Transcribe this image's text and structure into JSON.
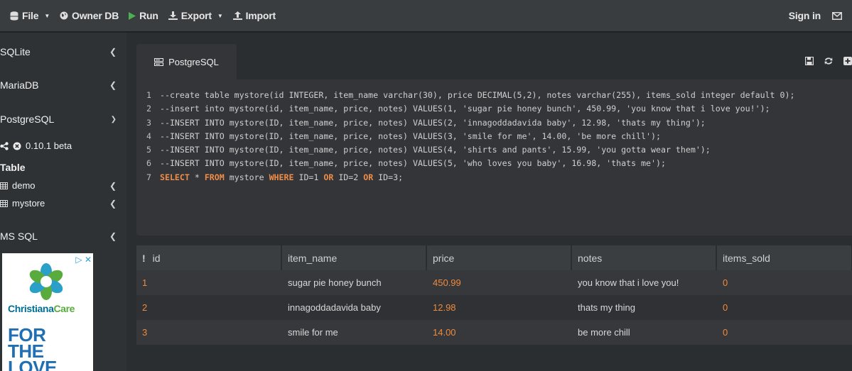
{
  "navbar": {
    "file": "File",
    "owner_db": "Owner DB",
    "run": "Run",
    "export": "Export",
    "import": "Import",
    "sign_in": "Sign in"
  },
  "sidebar": {
    "sqlite": "SQLite",
    "mariadb": "MariaDB",
    "postgresql": "PostgreSQL",
    "version": "0.10.1 beta",
    "table_heading": "Table",
    "tables": [
      "demo",
      "mystore"
    ],
    "mssql": "MS SQL"
  },
  "ad": {
    "brand_a": "Christiana",
    "brand_b": "Care",
    "headline": [
      "FOR",
      "THE",
      "LOVE"
    ]
  },
  "editor": {
    "tab_label": "PostgreSQL",
    "lines": [
      "--create table mystore(id INTEGER, item_name varchar(30), price DECIMAL(5,2), notes varchar(255), items_sold integer default 0);",
      "--insert into mystore(id, item_name, price, notes) VALUES(1, 'sugar pie honey bunch', 450.99, 'you know that i love you!');",
      "--INSERT INTO mystore(ID, item_name, price, notes) VALUES(2, 'innagoddadavida baby', 12.98, 'thats my thing');",
      "--INSERT INTO mystore(ID, item_name, price, notes) VALUES(3, 'smile for me', 14.00, 'be more chill');",
      "--INSERT INTO mystore(ID, item_name, price, notes) VALUES(4, 'shirts and pants', 15.99, 'you gotta wear them');",
      "--INSERT INTO mystore(ID, item_name, price, notes) VALUES(5, 'who loves you baby', 16.98, 'thats me');"
    ],
    "line_numbers": [
      "1",
      "2",
      "3",
      "4",
      "5",
      "6",
      "7"
    ],
    "last_line": {
      "select": "SELECT",
      "star": " * ",
      "from": "FROM",
      "table": " mystore ",
      "where": "WHERE",
      "c1": " ID=1 ",
      "or1": "OR",
      "c2": " ID=2 ",
      "or2": "OR",
      "c3": " ID=3;"
    }
  },
  "results": {
    "columns": [
      "id",
      "item_name",
      "price",
      "notes",
      "items_sold"
    ],
    "rows": [
      [
        "1",
        "sugar pie honey bunch",
        "450.99",
        "you know that i love you!",
        "0"
      ],
      [
        "2",
        "innagoddadavida baby",
        "12.98",
        "thats my thing",
        "0"
      ],
      [
        "3",
        "smile for me",
        "14.00",
        "be more chill",
        "0"
      ]
    ]
  }
}
